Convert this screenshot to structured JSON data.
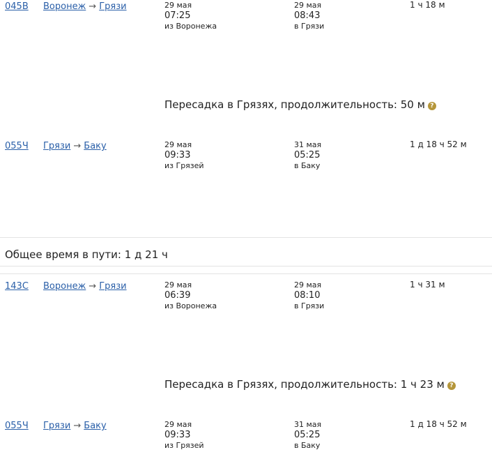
{
  "options": [
    {
      "legs": [
        {
          "train": "045В",
          "from": "Воронеж",
          "to": "Грязи",
          "dep_date": "29 мая",
          "dep_time": "07:25",
          "dep_station": "из Воронежа",
          "arr_date": "29 мая",
          "arr_time": "08:43",
          "arr_station": "в Грязи",
          "duration": "1 ч 18 м"
        },
        {
          "train": "055Ч",
          "from": "Грязи",
          "to": "Баку",
          "dep_date": "29 мая",
          "dep_time": "09:33",
          "dep_station": "из Грязей",
          "arr_date": "31 мая",
          "arr_time": "05:25",
          "arr_station": "в Баку",
          "duration": "1 д 18 ч 52 м"
        }
      ],
      "transfer": "Пересадка в Грязях, продолжительность: 50 м",
      "total": "Общее время в пути: 1 д 21 ч"
    },
    {
      "legs": [
        {
          "train": "143С",
          "from": "Воронеж",
          "to": "Грязи",
          "dep_date": "29 мая",
          "dep_time": "06:39",
          "dep_station": "из Воронежа",
          "arr_date": "29 мая",
          "arr_time": "08:10",
          "arr_station": "в Грязи",
          "duration": "1 ч 31 м"
        },
        {
          "train": "055Ч",
          "from": "Грязи",
          "to": "Баку",
          "dep_date": "29 мая",
          "dep_time": "09:33",
          "dep_station": "из Грязей",
          "arr_date": "31 мая",
          "arr_time": "05:25",
          "arr_station": "в Баку",
          "duration": "1 д 18 ч 52 м"
        }
      ],
      "transfer": "Пересадка в Грязях, продолжительность: 1 ч 23 м"
    }
  ],
  "icons": {
    "help": "question-icon",
    "arrow": "→"
  },
  "colors": {
    "link": "#2a5fa8",
    "help_icon": "#b5963a",
    "divider": "#e3e3e3"
  }
}
